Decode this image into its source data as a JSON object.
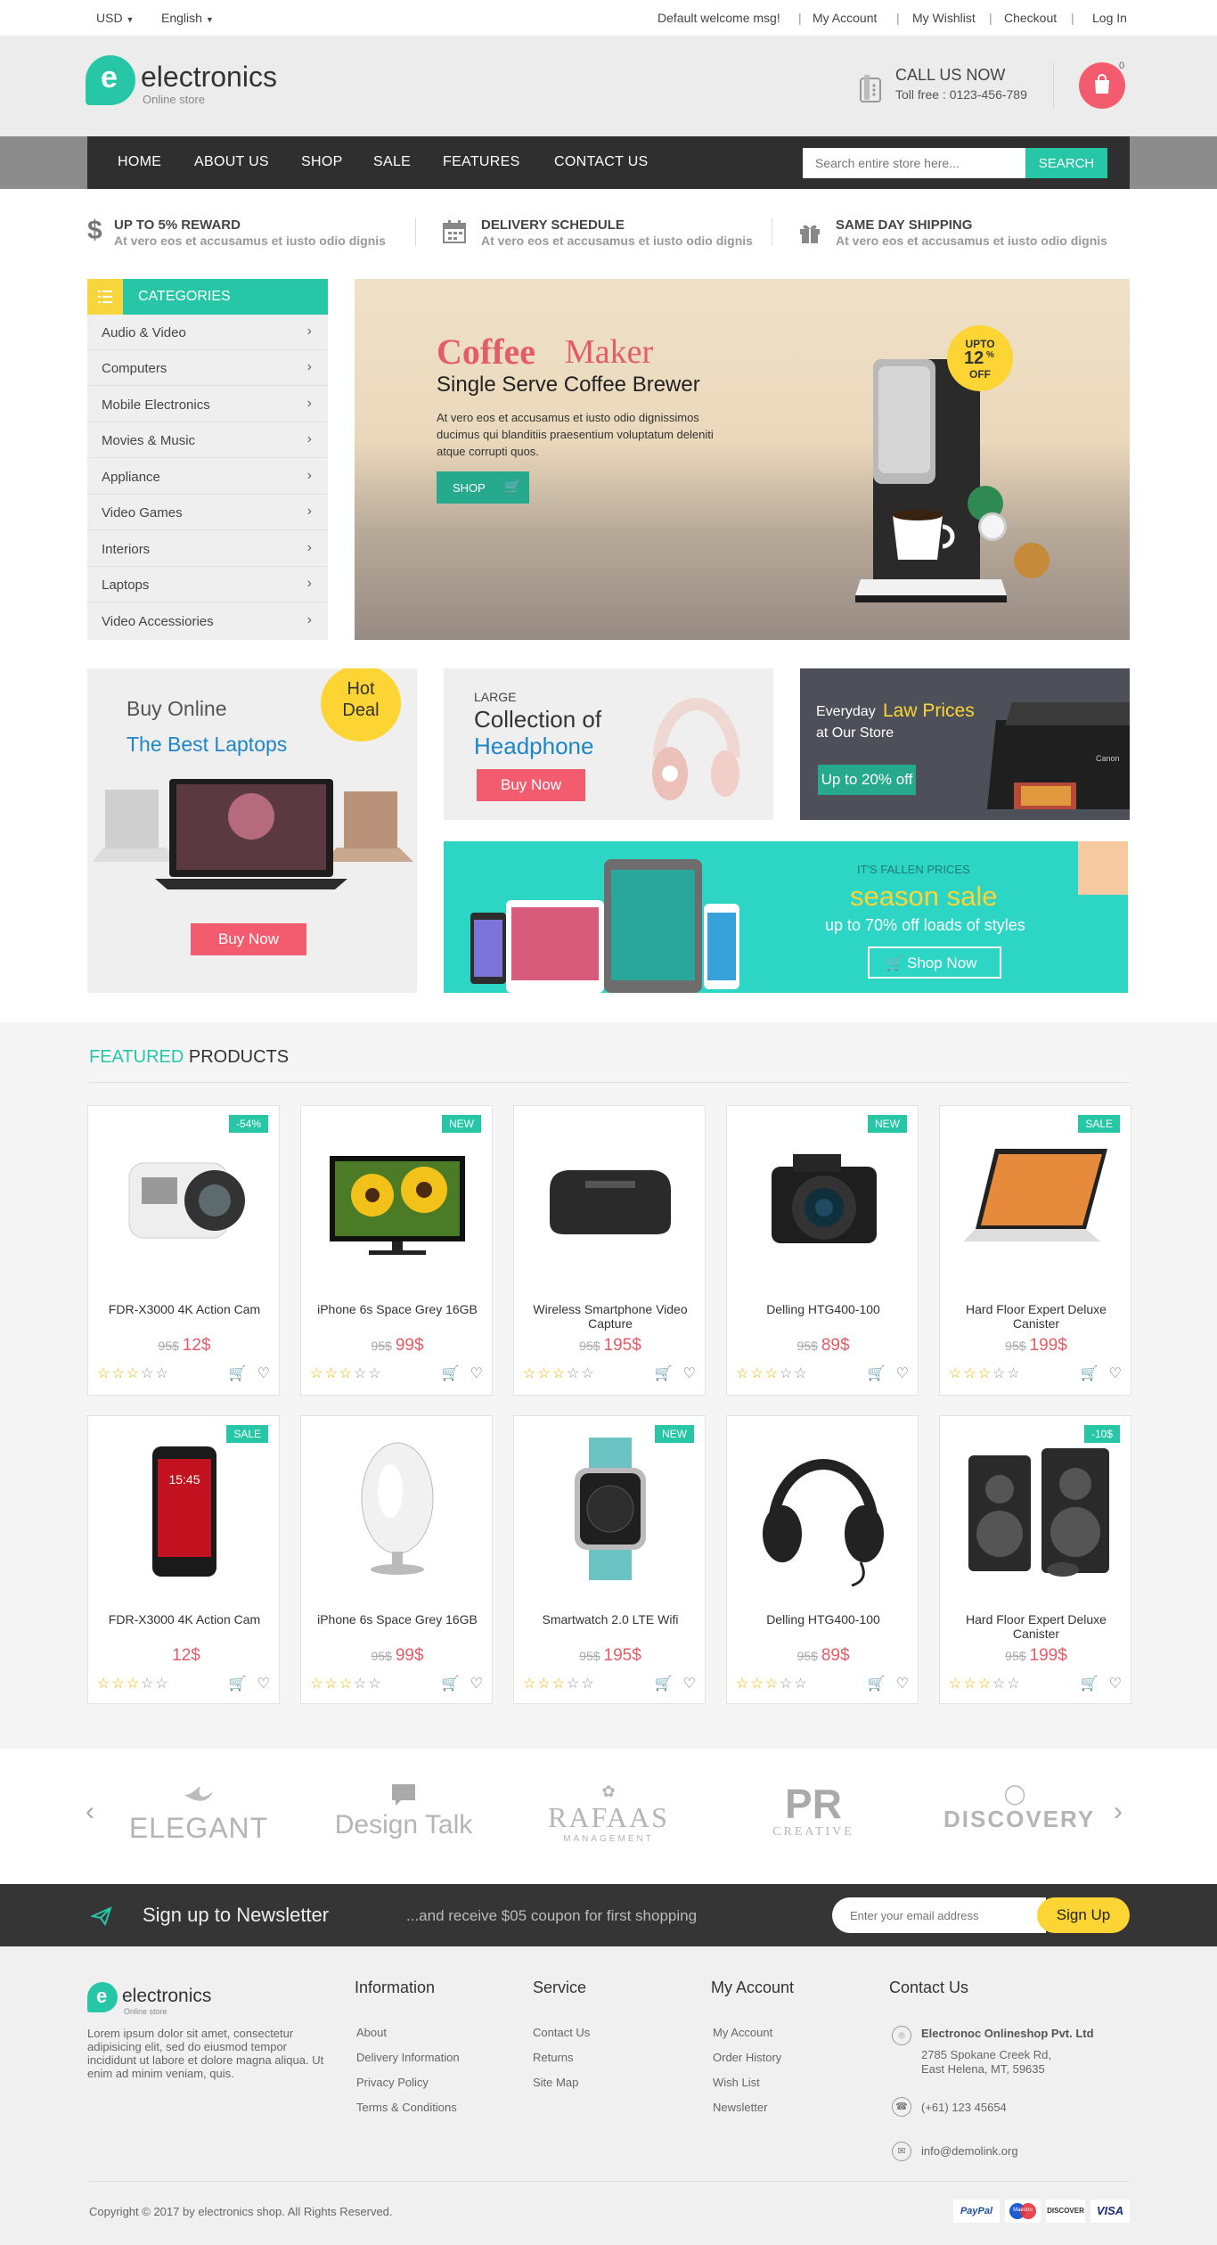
{
  "topbar": {
    "currency": "USD",
    "language": "English",
    "welcome": "Default welcome msg!",
    "links": [
      "My Account",
      "My Wishlist",
      "Checkout",
      "Log In"
    ]
  },
  "header": {
    "logo_letter": "e",
    "logo_name": "electronics",
    "logo_tagline": "Online store",
    "call_title": "CALL US NOW",
    "call_number": "Toll free : 0123-456-789",
    "cart_count": "0"
  },
  "nav": {
    "items": [
      "HOME",
      "ABOUT US",
      "SHOP",
      "SALE",
      "FEATURES",
      "CONTACT US"
    ],
    "search_placeholder": "Search entire store here...",
    "search_button": "SEARCH"
  },
  "features": [
    {
      "title": "UP TO 5% REWARD",
      "text": "At vero eos et accusamus et iusto odio dignis"
    },
    {
      "title": "DELIVERY SCHEDULE",
      "text": "At vero eos et accusamus et iusto odio dignis"
    },
    {
      "title": "SAME DAY SHIPPING",
      "text": "At vero eos et accusamus et iusto odio dignis"
    }
  ],
  "categories": {
    "title": "CATEGORIES",
    "items": [
      "Audio & Video",
      "Computers",
      "Mobile Electronics",
      "Movies & Music",
      "Appliance",
      "Video Games",
      "Interiors",
      "Laptops",
      "Video Accessiories"
    ]
  },
  "hero": {
    "title_a": "Coffee",
    "title_b": "Maker",
    "subtitle": "Single Serve Coffee Brewer",
    "text": "At vero eos et accusamus et iusto odio dignissimos ducimus qui blanditiis praesentium voluptatum deleniti atque corrupti quos.",
    "button": "SHOP",
    "badge_top": "UPTO",
    "badge_mid": "12",
    "badge_pct": "%",
    "badge_bottom": "OFF"
  },
  "banners": {
    "laptops": {
      "line1": "Buy Online",
      "line2": "The Best Laptops",
      "hot_1": "Hot",
      "hot_2": "Deal",
      "button": "Buy Now"
    },
    "headphone": {
      "small": "LARGE",
      "line1": "Collection of",
      "line2": "Headphone",
      "button": "Buy Now"
    },
    "printer": {
      "pre": "Everyday",
      "highlight": "Law Prices",
      "line2": "at Our Store",
      "button": "Up to 20% off",
      "brand": "Canon"
    },
    "season": {
      "small": "IT'S FALLEN PRICES",
      "title": "season sale",
      "sub": "up to 70% off loads of styles",
      "button": "Shop Now"
    }
  },
  "featured": {
    "title_a": "FEATURED",
    "title_b": "PRODUCTS",
    "products": [
      {
        "name": "FDR-X3000 4K Action Cam",
        "old": "95$",
        "price": "12$",
        "badge": "-54%",
        "stars": 3
      },
      {
        "name": "iPhone 6s Space Grey 16GB",
        "old": "95$",
        "price": "99$",
        "badge": "NEW",
        "stars": 3
      },
      {
        "name": "Wireless Smartphone Video Capture",
        "old": "95$",
        "price": "195$",
        "badge": "",
        "stars": 3
      },
      {
        "name": "Delling HTG400-100",
        "old": "95$",
        "price": "89$",
        "badge": "NEW",
        "stars": 3
      },
      {
        "name": "Hard Floor Expert Deluxe Canister",
        "old": "95$",
        "price": "199$",
        "badge": "SALE",
        "stars": 3
      },
      {
        "name": "FDR-X3000 4K Action Cam",
        "old": "",
        "price": "12$",
        "badge": "SALE",
        "stars": 3
      },
      {
        "name": "iPhone 6s Space Grey 16GB",
        "old": "95$",
        "price": "99$",
        "badge": "",
        "stars": 3
      },
      {
        "name": "Smartwatch 2.0 LTE Wifi",
        "old": "95$",
        "price": "195$",
        "badge": "NEW",
        "stars": 3
      },
      {
        "name": "Delling HTG400-100",
        "old": "95$",
        "price": "89$",
        "badge": "",
        "stars": 3
      },
      {
        "name": "Hard Floor Expert Deluxe Canister",
        "old": "95$",
        "price": "199$",
        "badge": "-10$",
        "stars": 3
      }
    ]
  },
  "brands": [
    {
      "name": "ELEGANT",
      "sub": ""
    },
    {
      "name": "Design Talk",
      "sub": ""
    },
    {
      "name": "RAFAAS",
      "sub": "MANAGEMENT"
    },
    {
      "name": "PR",
      "sub": "CREATIVE"
    },
    {
      "name": "DISCOVERY",
      "sub": ""
    }
  ],
  "newsletter": {
    "title": "Sign up to Newsletter",
    "text": "...and receive $05 coupon for first shopping",
    "placeholder": "Enter your email address",
    "button": "Sign Up"
  },
  "footer": {
    "about": "Lorem ipsum dolor sit amet, consectetur adipisicing elit, sed do eiusmod tempor incididunt ut labore et dolore magna aliqua. Ut enim ad minim veniam, quis.",
    "info_title": "Information",
    "info_links": [
      "About",
      "Delivery Information",
      "Privacy Policy",
      "Terms & Conditions"
    ],
    "service_title": "Service",
    "service_links": [
      "Contact Us",
      "Returns",
      "Site Map"
    ],
    "account_title": "My Account",
    "account_links": [
      "My Account",
      "Order History",
      "Wish List",
      "Newsletter"
    ],
    "contact_title": "Contact Us",
    "company": "Electronoc Onlineshop Pvt. Ltd",
    "address_1": "2785 Spokane Creek Rd,",
    "address_2": "East Helena, MT, 59635",
    "phone": "(+61) 123 45654",
    "email": "info@demolink.org",
    "copyright": "Copyright © 2017 by electronics shop. All Rights Reserved.",
    "payments": [
      "PayPal",
      "Maestro",
      "DISCOVER",
      "VISA"
    ]
  },
  "colors": {
    "accent": "#26c6a6",
    "pink": "#f25c6e",
    "yellow": "#fcd535",
    "dark": "#2f2f2f",
    "price": "#e35d66"
  }
}
